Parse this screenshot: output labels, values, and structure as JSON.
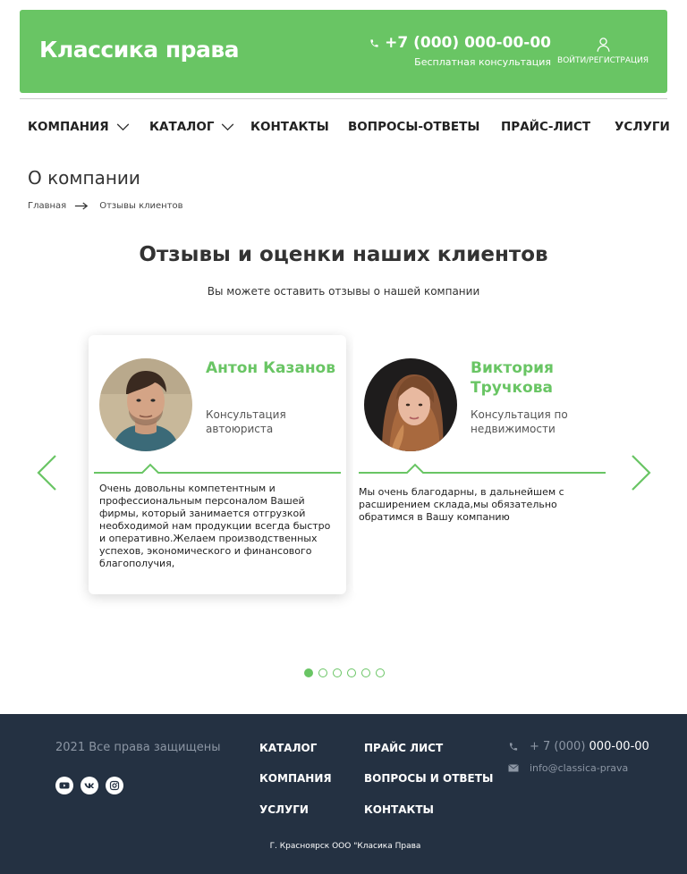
{
  "colors": {
    "accent": "#69c564",
    "footer_bg": "#243142",
    "muted": "#8c96a4"
  },
  "header": {
    "brand": "Классика права",
    "phone": "+7 (000) 000-00-00",
    "phone_sub": "Бесплатная консультация",
    "login_label": "ВОЙТИ/РЕГИСТРАЦИЯ"
  },
  "nav": {
    "items": [
      {
        "label": "КОМПАНИЯ",
        "has_dropdown": true
      },
      {
        "label": "КАТАЛОГ",
        "has_dropdown": true
      },
      {
        "label": "КОНТАКТЫ",
        "has_dropdown": false
      },
      {
        "label": "ВОПРОСЫ-ОТВЕТЫ",
        "has_dropdown": false
      },
      {
        "label": "ПРАЙС-ЛИСТ",
        "has_dropdown": false
      },
      {
        "label": "УСЛУГИ",
        "has_dropdown": false
      }
    ]
  },
  "page": {
    "title": "О компании",
    "breadcrumb": [
      "Главная",
      "Отзывы клиентов"
    ]
  },
  "reviews": {
    "title": "Отзывы и оценки наших клиентов",
    "subtitle": "Вы можете оставить отзывы о нашей компании",
    "cards": [
      {
        "name": "Антон Казанов",
        "service": "Консультация автоюриста",
        "text": "Очень довольны компетентным и профессиональным персоналом Вашей фирмы, который занимается отгрузкой необходимой нам продукции всегда быстро и оперативно.Желаем производственных успехов, экономического и финансового благополучия,"
      },
      {
        "name": "Виктория Тручкова",
        "service": "Консультация по недвижимости",
        "text": "Мы очень благодарны, в дальнейшем с расширением склада,мы обязательно обратимся  в Вашу компанию"
      }
    ],
    "pagination": {
      "total": 6,
      "current": 1
    }
  },
  "footer": {
    "copyright": "2021 Все права защищены",
    "socials": [
      "youtube-icon",
      "vk-icon",
      "instagram-icon"
    ],
    "links": [
      "КАТАЛОГ",
      "КОМПАНИЯ",
      "УСЛУГИ",
      "ПРАЙС ЛИСТ",
      "ВОПРОСЫ И ОТВЕТЫ",
      "КОНТАКТЫ"
    ],
    "phone_prefix": "+ 7 (000)",
    "phone_number": "000-00-00",
    "email": "info@classica-prava",
    "address": "Г. Красноярск  ООО \"Класика Права"
  }
}
